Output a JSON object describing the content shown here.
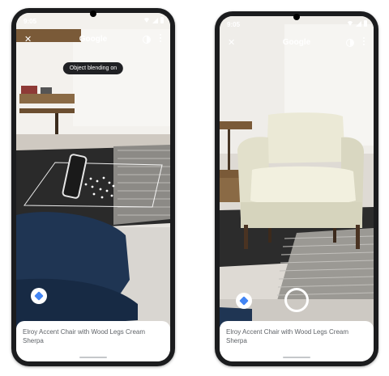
{
  "phones": [
    {
      "status_time": "9:05",
      "app_title": "Google",
      "toast": "Object blending on",
      "product_title": "Elroy Accent Chair with Wood Legs Cream Sherpa"
    },
    {
      "status_time": "9:05",
      "app_title": "Google",
      "product_title": "Elroy Accent Chair with Wood Legs Cream Sherpa"
    }
  ],
  "icons": {
    "close": "close-icon",
    "contrast": "contrast-icon",
    "more": "more-vert-icon",
    "ar": "cube-icon",
    "shutter": "shutter-icon"
  },
  "colors": {
    "phone_frame": "#1b1c1e",
    "accent": "#4285f4",
    "sheet_text": "#5f6368"
  }
}
